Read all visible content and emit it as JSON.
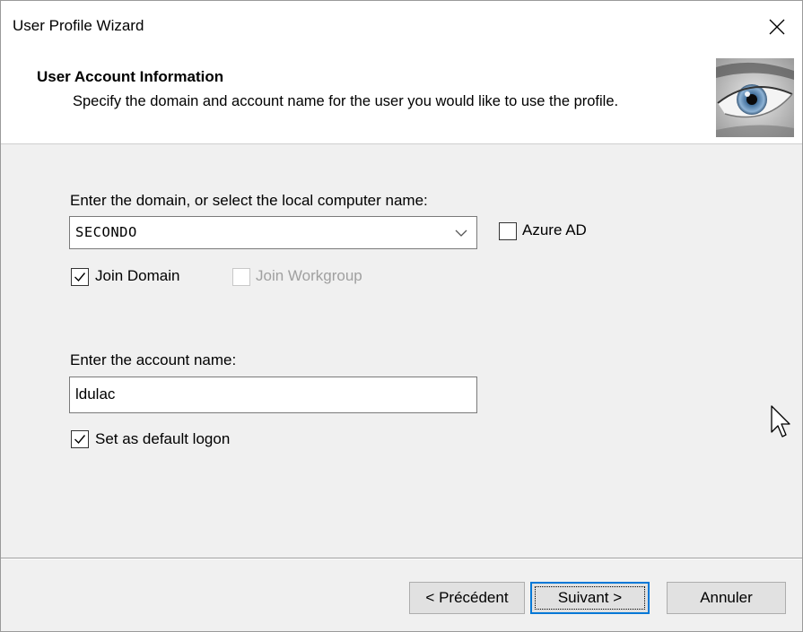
{
  "window": {
    "title": "User Profile Wizard"
  },
  "header": {
    "title": "User Account Information",
    "subtitle": "Specify the domain and account name for the user you would like to use the profile."
  },
  "domain": {
    "label": "Enter the domain, or select the local computer name:",
    "value": "SECONDO",
    "azure_label": "Azure AD",
    "azure_checked": false,
    "join_domain_label": "Join Domain",
    "join_domain_checked": true,
    "join_workgroup_label": "Join Workgroup",
    "join_workgroup_checked": false,
    "join_workgroup_enabled": false
  },
  "account": {
    "label": "Enter the account name:",
    "value": "ldulac",
    "default_logon_label": "Set as default logon",
    "default_logon_checked": true
  },
  "buttons": {
    "back": "< Précédent",
    "next": "Suivant >",
    "cancel": "Annuler"
  },
  "icons": {
    "close": "close-icon",
    "dropdown": "chevron-down-icon",
    "check": "check-icon",
    "cursor": "mouse-pointer-icon",
    "header_image": "eye-image"
  },
  "colors": {
    "window_bg": "#f0f0f0",
    "header_bg": "#ffffff",
    "button_bg": "#e1e1e1",
    "default_button_border": "#0078d7",
    "disabled_text": "#a0a0a0"
  }
}
